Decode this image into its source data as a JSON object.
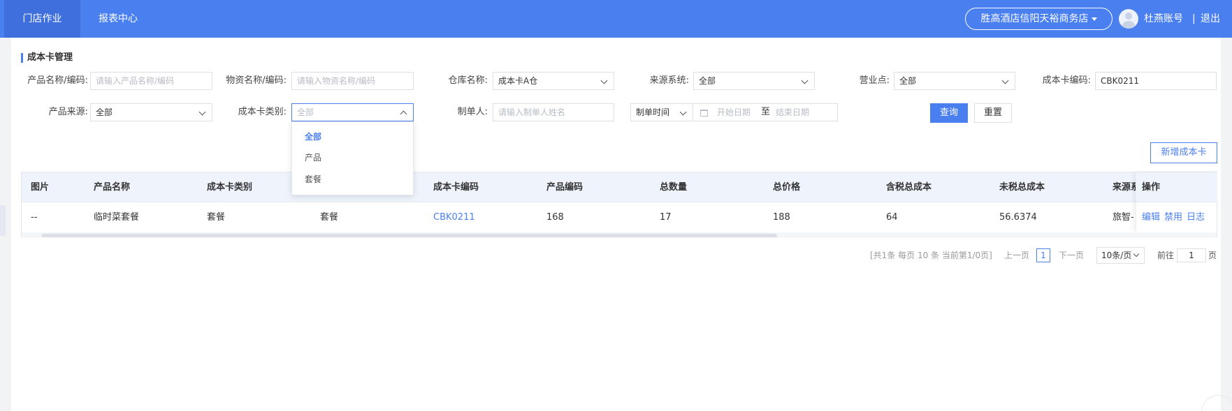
{
  "nav": {
    "items": [
      {
        "label": "门店作业",
        "active": true
      },
      {
        "label": "报表中心",
        "active": false
      }
    ],
    "store": "胜高酒店信阳天裕商务店",
    "user": "杜燕账号",
    "separator": "|",
    "logout": "退出"
  },
  "page_title": "成本卡管理",
  "filters": {
    "product_name": {
      "label": "产品名称/编码:",
      "placeholder": "请输入产品名称/编码"
    },
    "material_name": {
      "label": "物资名称/编码:",
      "placeholder": "请输入物资名称/编码"
    },
    "warehouse": {
      "label": "仓库名称:",
      "value": "成本卡A仓"
    },
    "source_system": {
      "label": "来源系统:",
      "value": "全部"
    },
    "business_point": {
      "label": "营业点:",
      "value": "全部"
    },
    "card_code": {
      "label": "成本卡编码:",
      "value": "CBK0211"
    },
    "product_source": {
      "label": "产品来源:",
      "value": "全部"
    },
    "card_type": {
      "label": "成本卡类别:",
      "placeholder": "全部"
    },
    "creator": {
      "label": "制单人:",
      "placeholder": "请输入制单人姓名"
    },
    "time_type": {
      "value": "制单时间"
    },
    "date_range": {
      "start": "开始日期",
      "to": "至",
      "end": "结束日期"
    }
  },
  "buttons": {
    "query": "查询",
    "reset": "重置",
    "add": "新增成本卡"
  },
  "card_type_dropdown": {
    "options": [
      "全部",
      "产品",
      "套餐"
    ],
    "selected": "全部"
  },
  "table": {
    "headers": [
      "图片",
      "产品名称",
      "成本卡类别",
      "",
      "成本卡编码",
      "产品编码",
      "总数量",
      "总价格",
      "含税总成本",
      "未税总成本",
      "来源系",
      "操作"
    ],
    "rows": [
      {
        "cells": [
          "--",
          "临时菜套餐",
          "套餐",
          "套餐",
          "CBK0211",
          "168",
          "17",
          "188",
          "64",
          "56.6374",
          "旅智-"
        ],
        "actions": [
          "编辑",
          "禁用",
          "日志"
        ]
      }
    ]
  },
  "pagination": {
    "summary": "[共1条 每页 10 条 当前第1/0页]",
    "prev": "上一页",
    "current": "1",
    "next": "下一页",
    "page_size": "10条/页",
    "goto_label": "前往",
    "goto_value": "1",
    "page_unit": "页"
  },
  "colors": {
    "primary": "#4a7ff0",
    "header_bg": "#eef3fc"
  }
}
